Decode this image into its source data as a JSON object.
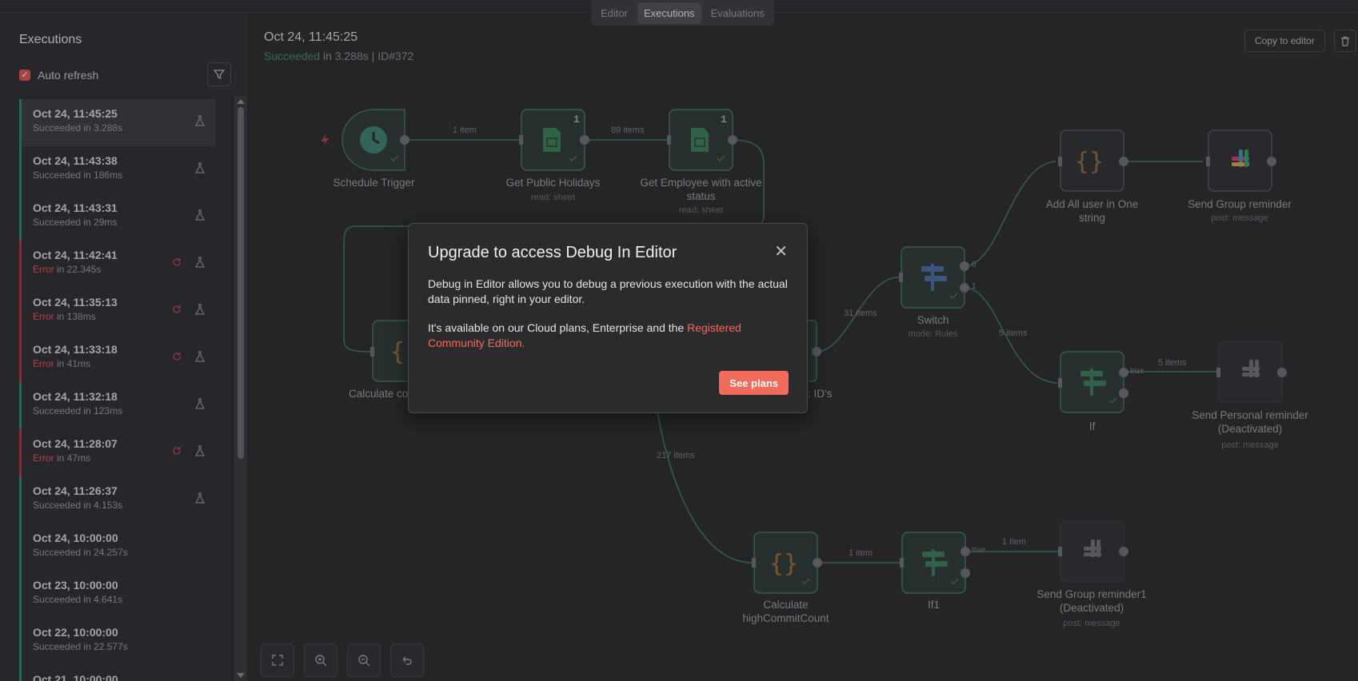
{
  "topbar": {
    "tabs": [
      {
        "label": "Editor",
        "active": false
      },
      {
        "label": "Executions",
        "active": true
      },
      {
        "label": "Evaluations",
        "active": false
      }
    ]
  },
  "sidebar": {
    "title": "Executions",
    "auto_refresh_label": "Auto refresh",
    "auto_refresh_checked": true,
    "executions": [
      {
        "time": "Oct 24, 11:45:25",
        "status": "Succeeded",
        "duration": " in 3.288s",
        "error": false,
        "selected": true
      },
      {
        "time": "Oct 24, 11:43:38",
        "status": "Succeeded",
        "duration": " in 186ms",
        "error": false
      },
      {
        "time": "Oct 24, 11:43:31",
        "status": "Succeeded",
        "duration": " in 29ms",
        "error": false
      },
      {
        "time": "Oct 24, 11:42:41",
        "status": "Error",
        "duration": " in 22.345s",
        "error": true
      },
      {
        "time": "Oct 24, 11:35:13",
        "status": "Error",
        "duration": " in 138ms",
        "error": true
      },
      {
        "time": "Oct 24, 11:33:18",
        "status": "Error",
        "duration": " in 41ms",
        "error": true
      },
      {
        "time": "Oct 24, 11:32:18",
        "status": "Succeeded",
        "duration": " in 123ms",
        "error": false
      },
      {
        "time": "Oct 24, 11:28:07",
        "status": "Error",
        "duration": " in 47ms",
        "error": true
      },
      {
        "time": "Oct 24, 11:26:37",
        "status": "Succeeded",
        "duration": " in 4.153s",
        "error": false
      },
      {
        "time": "Oct 24, 10:00:00",
        "status": "Succeeded",
        "duration": " in 24.257s",
        "error": false,
        "noflask": true
      },
      {
        "time": "Oct 23, 10:00:00",
        "status": "Succeeded",
        "duration": " in 4.641s",
        "error": false,
        "noflask": true
      },
      {
        "time": "Oct 22, 10:00:00",
        "status": "Succeeded",
        "duration": " in 22.577s",
        "error": false,
        "noflask": true
      },
      {
        "time": "Oct 21, 10:00:00",
        "status": "Succeeded",
        "duration": "",
        "error": false,
        "noflask": true
      }
    ]
  },
  "header": {
    "time": "Oct 24, 11:45:25",
    "status_ok": "Succeeded",
    "status_rest": " in 3.288s | ID#372",
    "copy_label": "Copy to editor"
  },
  "workflow": {
    "nodes": {
      "schedule": {
        "label": "Schedule Trigger"
      },
      "holidays": {
        "label": "Get Public Holidays",
        "sub": "read: sheet",
        "badge": "1"
      },
      "employees": {
        "label": "Get Employee with active status",
        "sub": "read: sheet",
        "badge": "1"
      },
      "calculate": {
        "label": "Calculate co"
      },
      "ids": {
        "label": ": ID's"
      },
      "switch": {
        "label": "Switch",
        "sub": "mode: Rules"
      },
      "addall": {
        "label": "Add All user in One string"
      },
      "sendgroup": {
        "label": "Send Group reminder",
        "sub": "post: message"
      },
      "if": {
        "label": "If"
      },
      "sendpersonal": {
        "label": "Send Personal reminder (Deactivated)",
        "sub": "post: message"
      },
      "calchigh": {
        "label": "Calculate highCommitCount"
      },
      "if1": {
        "label": "If1"
      },
      "sendgroup1": {
        "label": "Send Group reminder1 (Deactivated)",
        "sub": "post: message"
      }
    },
    "edges": {
      "e1": "1 item",
      "e2": "89 items",
      "e3": "31 items",
      "e4": "5 items",
      "e5": "5 items",
      "e6": "217 items",
      "e7": "1 item",
      "e8": "1 item",
      "out0": "0",
      "out1": "1",
      "true1": "true",
      "true2": "true"
    }
  },
  "modal": {
    "title": "Upgrade to access Debug In Editor",
    "body1": "Debug in Editor allows you to debug a previous execution with the actual data pinned, right in your editor.",
    "body2_prefix": "It's available on our Cloud plans, Enterprise and the ",
    "body2_link": "Registered Community Edition.",
    "button": "See plans"
  },
  "colors": {
    "accent": "#f26b5b",
    "success": "#3f8a6b",
    "error": "#d05a5f"
  }
}
